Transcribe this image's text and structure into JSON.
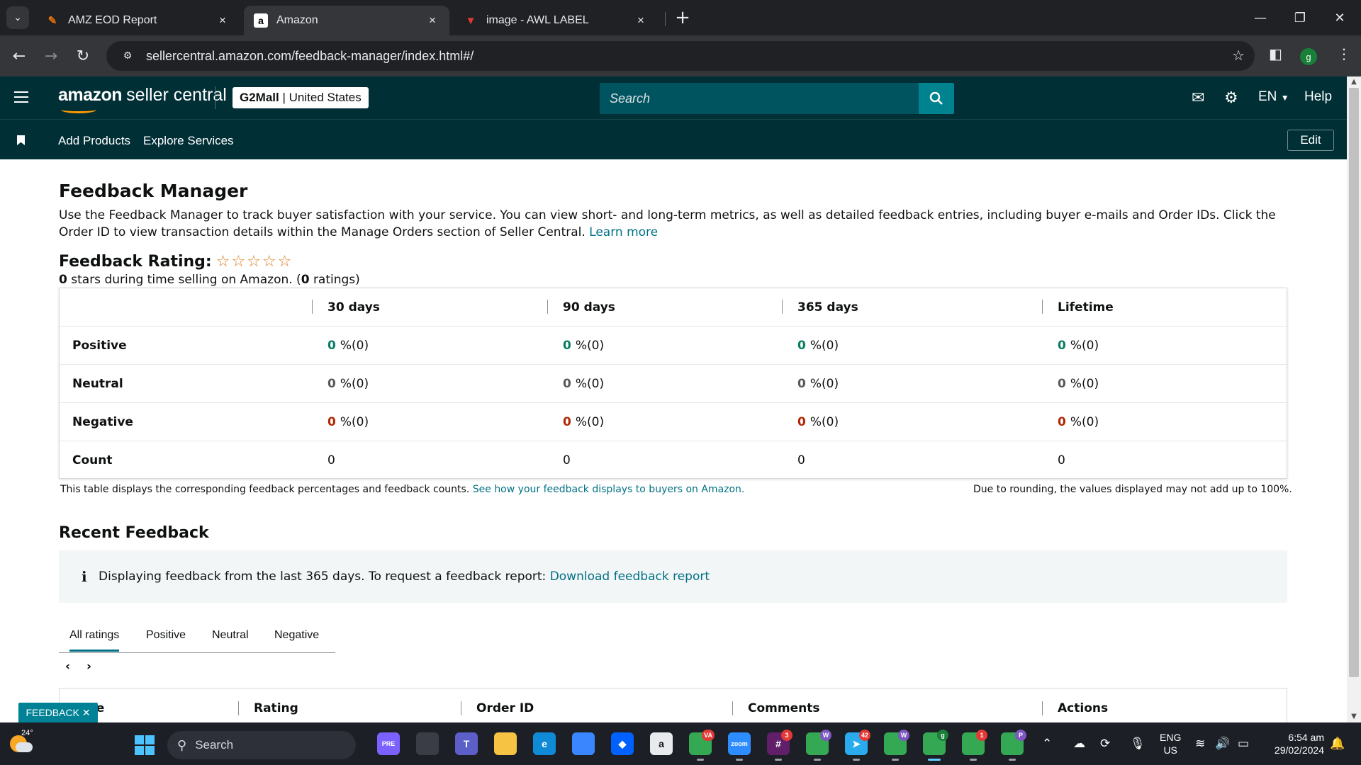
{
  "browser": {
    "tabs": [
      {
        "title": "AMZ EOD Report",
        "favicon": "report-icon"
      },
      {
        "title": "Amazon",
        "favicon": "amazon-a-icon"
      },
      {
        "title": "image - AWL LABEL",
        "favicon": "awl-label-icon"
      }
    ],
    "url": "sellercentral.amazon.com/feedback-manager/index.html#/",
    "profile_initial": "g"
  },
  "header": {
    "logo_bold": "amazon",
    "logo_rest": "seller central",
    "store_name": "G2Mall",
    "store_sep": "|",
    "store_region": "United States",
    "search_placeholder": "Search",
    "lang": "EN",
    "help": "Help"
  },
  "nav": {
    "links": [
      "Add Products",
      "Explore Services"
    ],
    "edit_label": "Edit"
  },
  "page": {
    "title": "Feedback Manager",
    "intro": "Use the Feedback Manager to track buyer satisfaction with your service. You can view short- and long-term metrics, as well as detailed feedback entries, including buyer e-mails and Order IDs. Click the Order ID to view transaction details within the Manage Orders section of Seller Central.",
    "learn_more": "Learn more",
    "rating_label": "Feedback Rating:",
    "rating_stars_filled": 0,
    "rating_stars_total": 5,
    "rating_sub_count": "0",
    "rating_sub_text_1": "stars during time selling on Amazon. (",
    "rating_sub_ratings": "0",
    "rating_sub_text_2": "ratings)"
  },
  "metrics": {
    "columns": [
      "30 days",
      "90 days",
      "365 days",
      "Lifetime"
    ],
    "rows": [
      {
        "label": "Positive",
        "kind": "pos",
        "cells": [
          {
            "n": "0",
            "p": "%(0)"
          },
          {
            "n": "0",
            "p": "%(0)"
          },
          {
            "n": "0",
            "p": "%(0)"
          },
          {
            "n": "0",
            "p": "%(0)"
          }
        ]
      },
      {
        "label": "Neutral",
        "kind": "neu",
        "cells": [
          {
            "n": "0",
            "p": "%(0)"
          },
          {
            "n": "0",
            "p": "%(0)"
          },
          {
            "n": "0",
            "p": "%(0)"
          },
          {
            "n": "0",
            "p": "%(0)"
          }
        ]
      },
      {
        "label": "Negative",
        "kind": "neg",
        "cells": [
          {
            "n": "0",
            "p": "%(0)"
          },
          {
            "n": "0",
            "p": "%(0)"
          },
          {
            "n": "0",
            "p": "%(0)"
          },
          {
            "n": "0",
            "p": "%(0)"
          }
        ]
      },
      {
        "label": "Count",
        "kind": "count",
        "cells": [
          "0",
          "0",
          "0",
          "0"
        ]
      }
    ],
    "note": "This table displays the corresponding feedback percentages and feedback counts.",
    "note_link": "See how your feedback displays to buyers on Amazon.",
    "rounding_note": "Due to rounding, the values displayed may not add up to 100%."
  },
  "recent": {
    "title": "Recent Feedback",
    "info": "Displaying feedback from the last 365 days. To request a feedback report:",
    "info_link": "Download feedback report",
    "tabs": [
      "All ratings",
      "Positive",
      "Neutral",
      "Negative"
    ],
    "active_tab": 0,
    "prev": "‹",
    "next": "›",
    "columns": [
      "Date",
      "Rating",
      "Order ID",
      "Comments",
      "Actions"
    ]
  },
  "feedback_button": "FEEDBACK",
  "taskbar": {
    "temp": "24°",
    "search": "Search",
    "apps": [
      {
        "name": "copilot-pre-icon",
        "label": "PRE",
        "color": "#7b61ff"
      },
      {
        "name": "task-view-icon",
        "label": "",
        "color": "#3a3d45"
      },
      {
        "name": "teams-icon",
        "label": "T",
        "color": "#5b5fc7"
      },
      {
        "name": "file-explorer-icon",
        "label": "",
        "color": "#f6c343"
      },
      {
        "name": "edge-icon",
        "label": "e",
        "color": "#0f8ad6"
      },
      {
        "name": "store-icon",
        "label": "",
        "color": "#3a86ff"
      },
      {
        "name": "dropbox-icon",
        "label": "◆",
        "color": "#0061fe"
      },
      {
        "name": "amazon-icon",
        "label": "a",
        "color": "#e8eaed"
      },
      {
        "name": "chrome-va-icon",
        "label": "",
        "color": "#34a853",
        "badge": "VA"
      },
      {
        "name": "zoom-icon",
        "label": "zoom",
        "color": "#2d8cff"
      },
      {
        "name": "slack-icon",
        "label": "#",
        "color": "#611f69",
        "badge": "3"
      },
      {
        "name": "chrome-w-icon",
        "label": "",
        "color": "#34a853",
        "badge": "W"
      },
      {
        "name": "telegram-icon",
        "label": "➤",
        "color": "#2aabee",
        "badge": "42"
      },
      {
        "name": "chrome-w2-icon",
        "label": "",
        "color": "#34a853",
        "badge": "W"
      },
      {
        "name": "chrome-g-icon",
        "label": "",
        "color": "#34a853",
        "badge": "g"
      },
      {
        "name": "chrome-1-icon",
        "label": "",
        "color": "#34a853",
        "badge": "1"
      },
      {
        "name": "chrome-p-icon",
        "label": "",
        "color": "#34a853",
        "badge": "P"
      }
    ],
    "lang_top": "ENG",
    "lang_bottom": "US",
    "time": "6:54 am",
    "date": "29/02/2024"
  }
}
